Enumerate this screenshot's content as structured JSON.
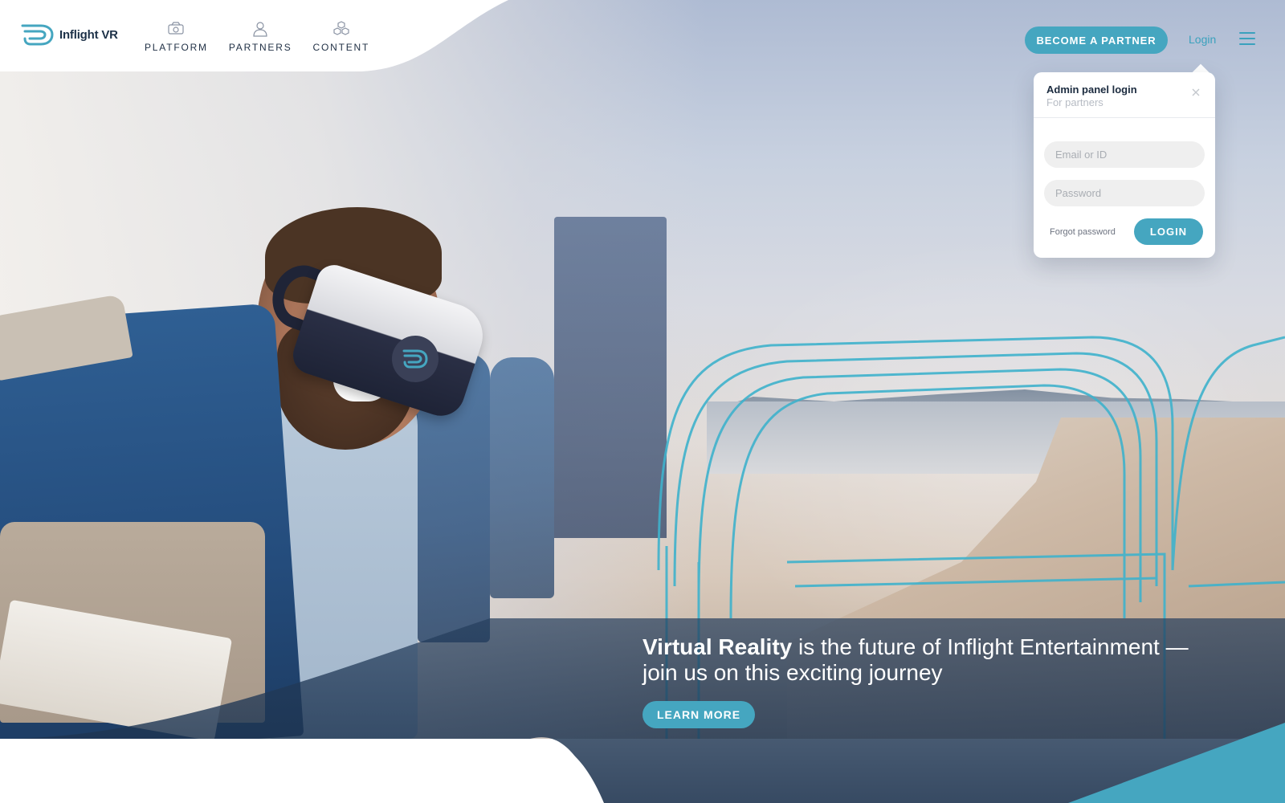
{
  "brand": {
    "name": "Inflight VR",
    "accent_color": "#45a6c0",
    "text_color": "#1d3148"
  },
  "nav": {
    "items": [
      {
        "label": "PLATFORM",
        "icon": "platform-icon"
      },
      {
        "label": "PARTNERS",
        "icon": "partners-icon"
      },
      {
        "label": "CONTENT",
        "icon": "content-icon"
      }
    ]
  },
  "header": {
    "partner_button": "BECOME A PARTNER",
    "login_link": "Login",
    "menu_icon": "hamburger-menu-icon"
  },
  "login_popover": {
    "title": "Admin panel login",
    "subtitle": "For partners",
    "close_icon": "close-icon",
    "email_placeholder": "Email or ID",
    "password_placeholder": "Password",
    "forgot_link": "Forgot password",
    "login_button": "LOGIN"
  },
  "hero": {
    "tagline_bold": "Virtual Reality",
    "tagline_rest": " is the future of Inflight Entertainment — join us on this exciting journey",
    "cta_button": "LEARN MORE"
  }
}
